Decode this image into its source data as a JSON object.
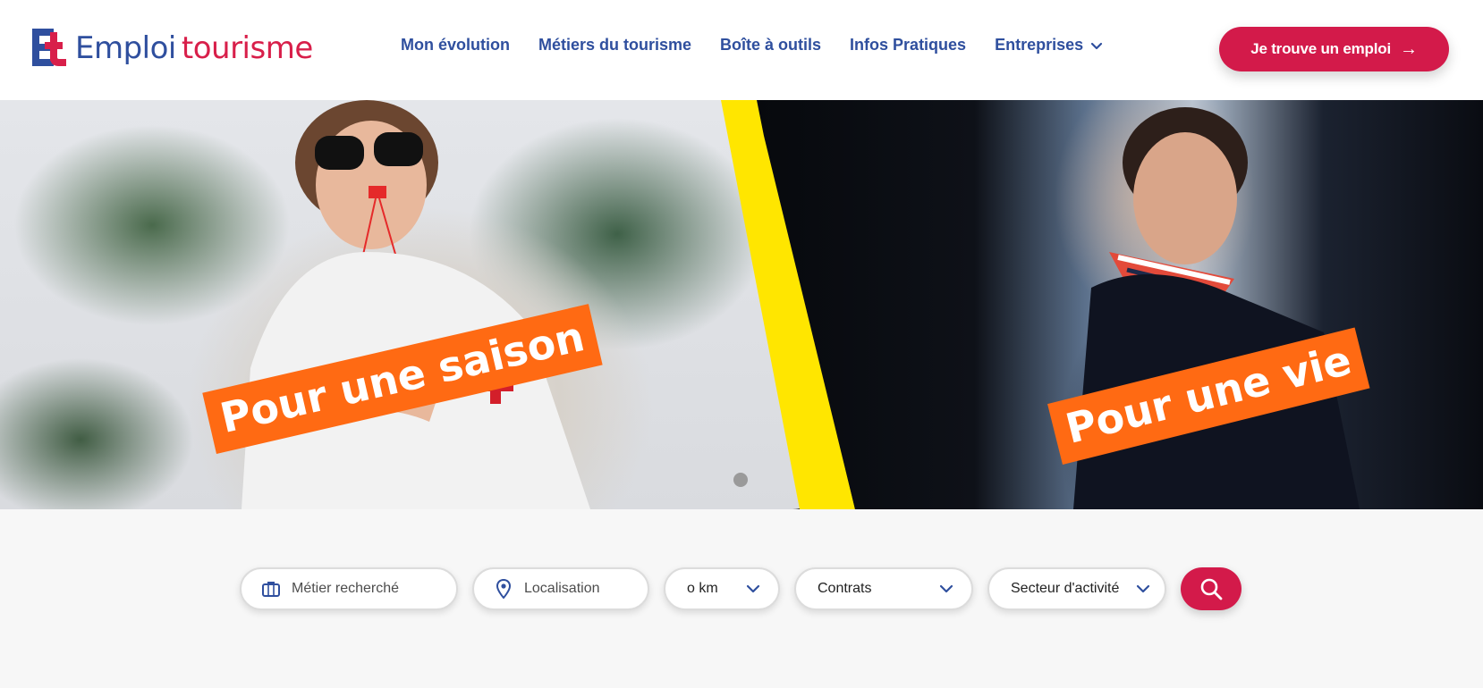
{
  "brand": {
    "logo_mark": "Et",
    "name_part1": "Emploi",
    "name_part2": "tourisme",
    "color_blue": "#2f4f9e",
    "color_red": "#d81f4a"
  },
  "nav": {
    "items": [
      {
        "label": "Mon évolution"
      },
      {
        "label": "Métiers du tourisme"
      },
      {
        "label": "Boîte à outils"
      },
      {
        "label": "Infos Pratiques"
      },
      {
        "label": "Entreprises",
        "has_dropdown": true
      }
    ]
  },
  "cta": {
    "label": "Je trouve un emploi",
    "arrow": "→",
    "color": "#d31a4a"
  },
  "hero": {
    "left_banner": "Pour une saison",
    "right_banner": "Pour une vie",
    "banner_color": "#ff6a13",
    "accent_yellow": "#ffe600",
    "carousel_dots": 1
  },
  "search": {
    "metier_placeholder": "Métier recherché",
    "location_placeholder": "Localisation",
    "distance_value": "o km",
    "contracts_value": "Contrats",
    "sector_value": "Secteur d'activité",
    "submit_icon": "search-icon"
  }
}
